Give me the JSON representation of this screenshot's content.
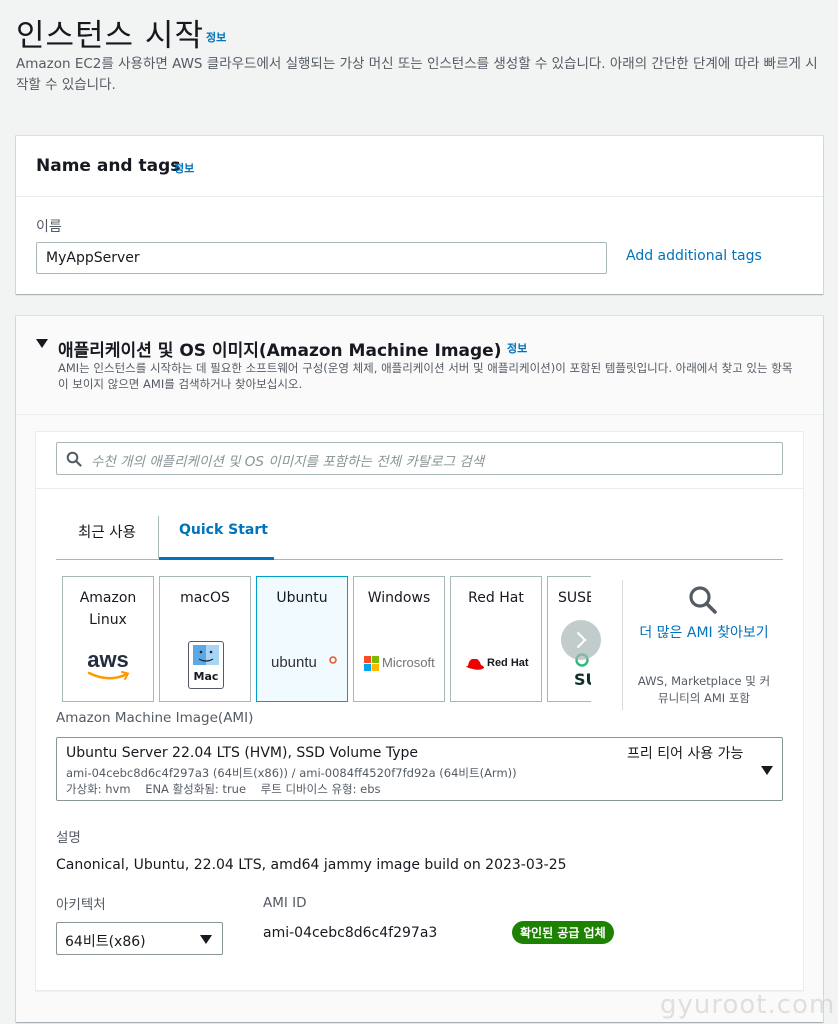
{
  "page": {
    "title": "인스턴스 시작",
    "info": "정보",
    "description": "Amazon EC2를 사용하면 AWS 클라우드에서 실행되는 가상 머신 또는 인스턴스를 생성할 수 있습니다. 아래의 간단한 단계에 따라 빠르게 시작할 수 있습니다."
  },
  "name_tags": {
    "heading": "Name and tags",
    "info": "정보",
    "name_label": "이름",
    "name_value": "MyAppServer",
    "add_tags": "Add additional tags"
  },
  "ami": {
    "heading": "애플리케이션 및 OS 이미지(Amazon Machine Image)",
    "info": "정보",
    "description": "AMI는 인스턴스를 시작하는 데 필요한 소프트웨어 구성(운영 체제, 애플리케이션 서버 및 애플리케이션)이 포함된 템플릿입니다. 아래에서 찾고 있는 항목이 보이지 않으면 AMI를 검색하거나 찾아보십시오.",
    "search_placeholder": "수천 개의 애플리케이션 및 OS 이미지를 포함하는 전체 카탈로그 검색",
    "tabs": [
      "최근 사용",
      "Quick Start"
    ],
    "active_tab": "Quick Start",
    "tiles": [
      {
        "name": "Amazon Linux",
        "logo": "aws"
      },
      {
        "name": "macOS",
        "logo": "Mac"
      },
      {
        "name": "Ubuntu",
        "logo": "ubuntu"
      },
      {
        "name": "Windows",
        "logo": "Microsoft"
      },
      {
        "name": "Red Hat",
        "logo": "Red Hat"
      },
      {
        "name": "SUSE",
        "logo": "SU"
      }
    ],
    "more": {
      "title": "더 많은 AMI 찾아보기",
      "subtitle": "AWS, Marketplace 및 커뮤니티의 AMI 포함"
    },
    "select_label": "Amazon Machine Image(AMI)",
    "selected": {
      "name": "Ubuntu Server 22.04 LTS (HVM), SSD Volume Type",
      "free_tier": "프리 티어 사용 가능",
      "ids": "ami-04cebc8d6c4f297a3 (64비트(x86)) / ami-0084ff4520f7fd92a (64비트(Arm))",
      "meta": "가상화: hvm    ENA 활성화됨: true    루트 디바이스 유형: ebs"
    },
    "desc_label": "설명",
    "desc_value": "Canonical, Ubuntu, 22.04 LTS, amd64 jammy image build on 2023-03-25",
    "arch_label": "아키텍처",
    "arch_value": "64비트(x86)",
    "ami_id_label": "AMI ID",
    "ami_id_value": "ami-04cebc8d6c4f297a3",
    "verified": "확인된 공급 업체"
  },
  "watermark": "gyuroot.com",
  "colors": {
    "link": "#0073bb",
    "selected_tile_border": "#00a1c9",
    "badge": "#1d8102"
  }
}
